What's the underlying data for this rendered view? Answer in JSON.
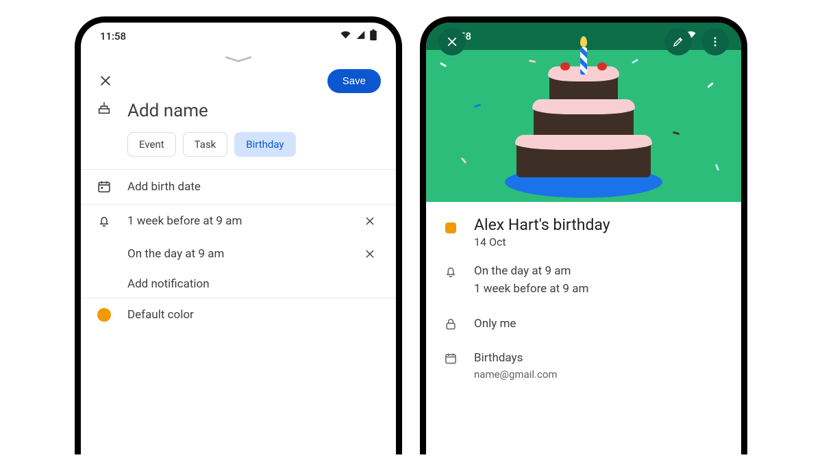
{
  "status_time": "11:58",
  "phone1": {
    "save_label": "Save",
    "name_placeholder": "Add name",
    "chips": {
      "event": "Event",
      "task": "Task",
      "birthday": "Birthday"
    },
    "birth_date_label": "Add birth date",
    "notifications": {
      "n1": "1 week before at 9 am",
      "n2": "On the day at 9 am",
      "add": "Add notification"
    },
    "color_label": "Default color",
    "color_hex": "#f29900"
  },
  "phone2": {
    "title": "Alex Hart's birthday",
    "date": "14 Oct",
    "reminders": {
      "r1": "On the day at 9 am",
      "r2": "1 week before at 9 am"
    },
    "visibility": "Only me",
    "calendar_name": "Birthdays",
    "calendar_account": "name@gmail.com"
  }
}
